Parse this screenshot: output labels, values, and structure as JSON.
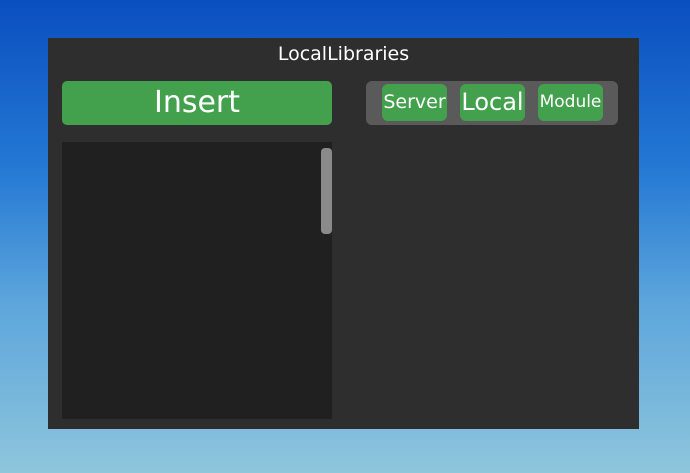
{
  "window": {
    "title": "LocalLibraries"
  },
  "insert_label": "Insert",
  "modes": [
    {
      "label": "Server"
    },
    {
      "label": "Local"
    },
    {
      "label": "Module"
    }
  ]
}
